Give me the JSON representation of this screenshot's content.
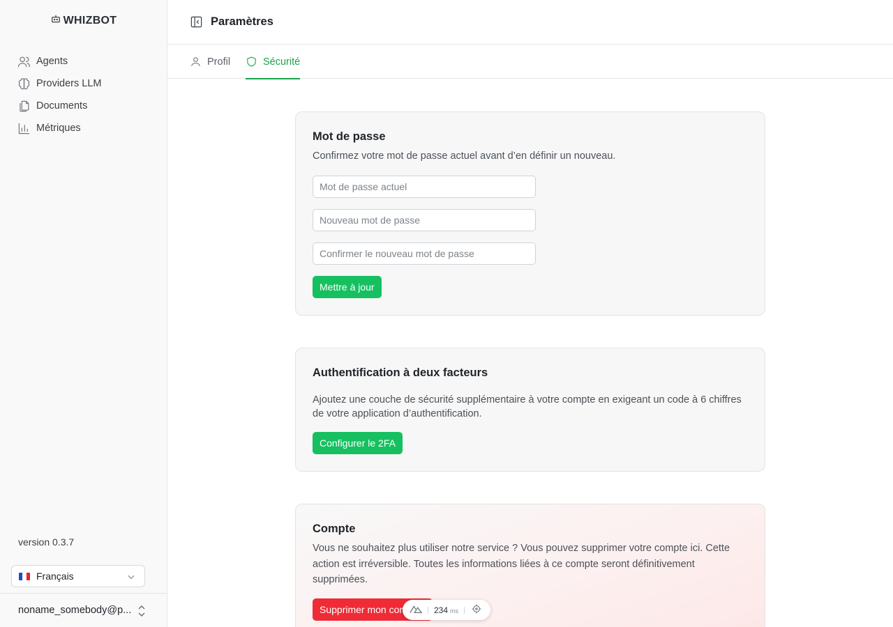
{
  "brand": {
    "name": "WHIZBOT",
    "icon": "robot-icon"
  },
  "sidebar": {
    "items": [
      {
        "label": "Agents",
        "icon": "users-icon"
      },
      {
        "label": "Providers LLM",
        "icon": "brain-icon"
      },
      {
        "label": "Documents",
        "icon": "documents-icon"
      },
      {
        "label": "Métriques",
        "icon": "bar-chart-icon"
      }
    ],
    "version": "version 0.3.7",
    "language": {
      "selected": "Français",
      "flag": "fr"
    },
    "user": "noname_somebody@p..."
  },
  "header": {
    "title": "Paramètres",
    "toggle_icon": "sidebar-toggle-icon"
  },
  "tabs": [
    {
      "label": "Profil",
      "icon": "user-icon",
      "active": false
    },
    {
      "label": "Sécurité",
      "icon": "shield-icon",
      "active": true
    }
  ],
  "password_card": {
    "title": "Mot de passe",
    "description": "Confirmez votre mot de passe actuel avant d’en définir un nouveau.",
    "current_placeholder": "Mot de passe actuel",
    "new_placeholder": "Nouveau mot de passe",
    "confirm_placeholder": "Confirmer le nouveau mot de passe",
    "submit_label": "Mettre à jour"
  },
  "twofa_card": {
    "title": "Authentification à deux facteurs",
    "description": "Ajoutez une couche de sécurité supplémentaire à votre compte en exigeant un code à 6 chiffres de votre application d’authentification.",
    "button_label": "Configurer le 2FA"
  },
  "account_card": {
    "title": "Compte",
    "description": "Vous ne souhaitez plus utiliser notre service ? Vous pouvez supprimer votre compte ici. Cette action est irréversible. Toutes les informations liées à ce compte seront définitivement supprimées.",
    "delete_label": "Supprimer mon compte"
  },
  "devbar": {
    "value": "234",
    "unit": "ms"
  },
  "colors": {
    "accent": "#17a34a",
    "primary_button": "#16c060",
    "danger": "#ef2b36"
  }
}
